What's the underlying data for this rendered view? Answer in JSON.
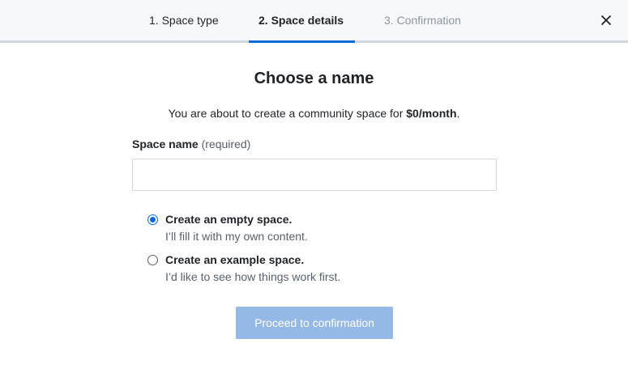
{
  "stepper": {
    "steps": [
      {
        "label": "1. Space type",
        "state": "done"
      },
      {
        "label": "2. Space details",
        "state": "active"
      },
      {
        "label": "3. Confirmation",
        "state": "pending"
      }
    ],
    "close_icon": "close-icon"
  },
  "main": {
    "title": "Choose a name",
    "subtitle_prefix": "You are about to create a community space for ",
    "subtitle_price": "$0/month",
    "subtitle_suffix": ".",
    "field": {
      "label": "Space name",
      "hint": "(required)",
      "value": "",
      "placeholder": ""
    },
    "options": [
      {
        "title": "Create an empty space.",
        "description": "I’ll fill it with my own content.",
        "selected": true
      },
      {
        "title": "Create an example space.",
        "description": "I’d like to see how things work first.",
        "selected": false
      }
    ],
    "proceed_label": "Proceed to confirmation"
  },
  "colors": {
    "accent": "#0969da",
    "button_disabled": "#94b9e6",
    "header_bg": "#f6f8fa"
  }
}
